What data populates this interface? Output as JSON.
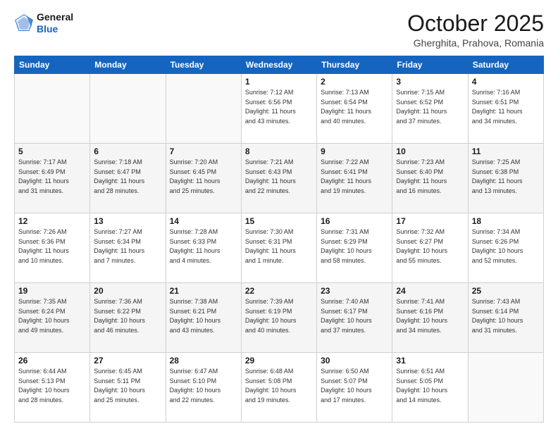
{
  "header": {
    "logo_line1": "General",
    "logo_line2": "Blue",
    "month": "October 2025",
    "location": "Gherghita, Prahova, Romania"
  },
  "days_of_week": [
    "Sunday",
    "Monday",
    "Tuesday",
    "Wednesday",
    "Thursday",
    "Friday",
    "Saturday"
  ],
  "weeks": [
    [
      {
        "day": "",
        "detail": ""
      },
      {
        "day": "",
        "detail": ""
      },
      {
        "day": "",
        "detail": ""
      },
      {
        "day": "1",
        "detail": "Sunrise: 7:12 AM\nSunset: 6:56 PM\nDaylight: 11 hours\nand 43 minutes."
      },
      {
        "day": "2",
        "detail": "Sunrise: 7:13 AM\nSunset: 6:54 PM\nDaylight: 11 hours\nand 40 minutes."
      },
      {
        "day": "3",
        "detail": "Sunrise: 7:15 AM\nSunset: 6:52 PM\nDaylight: 11 hours\nand 37 minutes."
      },
      {
        "day": "4",
        "detail": "Sunrise: 7:16 AM\nSunset: 6:51 PM\nDaylight: 11 hours\nand 34 minutes."
      }
    ],
    [
      {
        "day": "5",
        "detail": "Sunrise: 7:17 AM\nSunset: 6:49 PM\nDaylight: 11 hours\nand 31 minutes."
      },
      {
        "day": "6",
        "detail": "Sunrise: 7:18 AM\nSunset: 6:47 PM\nDaylight: 11 hours\nand 28 minutes."
      },
      {
        "day": "7",
        "detail": "Sunrise: 7:20 AM\nSunset: 6:45 PM\nDaylight: 11 hours\nand 25 minutes."
      },
      {
        "day": "8",
        "detail": "Sunrise: 7:21 AM\nSunset: 6:43 PM\nDaylight: 11 hours\nand 22 minutes."
      },
      {
        "day": "9",
        "detail": "Sunrise: 7:22 AM\nSunset: 6:41 PM\nDaylight: 11 hours\nand 19 minutes."
      },
      {
        "day": "10",
        "detail": "Sunrise: 7:23 AM\nSunset: 6:40 PM\nDaylight: 11 hours\nand 16 minutes."
      },
      {
        "day": "11",
        "detail": "Sunrise: 7:25 AM\nSunset: 6:38 PM\nDaylight: 11 hours\nand 13 minutes."
      }
    ],
    [
      {
        "day": "12",
        "detail": "Sunrise: 7:26 AM\nSunset: 6:36 PM\nDaylight: 11 hours\nand 10 minutes."
      },
      {
        "day": "13",
        "detail": "Sunrise: 7:27 AM\nSunset: 6:34 PM\nDaylight: 11 hours\nand 7 minutes."
      },
      {
        "day": "14",
        "detail": "Sunrise: 7:28 AM\nSunset: 6:33 PM\nDaylight: 11 hours\nand 4 minutes."
      },
      {
        "day": "15",
        "detail": "Sunrise: 7:30 AM\nSunset: 6:31 PM\nDaylight: 11 hours\nand 1 minute."
      },
      {
        "day": "16",
        "detail": "Sunrise: 7:31 AM\nSunset: 6:29 PM\nDaylight: 10 hours\nand 58 minutes."
      },
      {
        "day": "17",
        "detail": "Sunrise: 7:32 AM\nSunset: 6:27 PM\nDaylight: 10 hours\nand 55 minutes."
      },
      {
        "day": "18",
        "detail": "Sunrise: 7:34 AM\nSunset: 6:26 PM\nDaylight: 10 hours\nand 52 minutes."
      }
    ],
    [
      {
        "day": "19",
        "detail": "Sunrise: 7:35 AM\nSunset: 6:24 PM\nDaylight: 10 hours\nand 49 minutes."
      },
      {
        "day": "20",
        "detail": "Sunrise: 7:36 AM\nSunset: 6:22 PM\nDaylight: 10 hours\nand 46 minutes."
      },
      {
        "day": "21",
        "detail": "Sunrise: 7:38 AM\nSunset: 6:21 PM\nDaylight: 10 hours\nand 43 minutes."
      },
      {
        "day": "22",
        "detail": "Sunrise: 7:39 AM\nSunset: 6:19 PM\nDaylight: 10 hours\nand 40 minutes."
      },
      {
        "day": "23",
        "detail": "Sunrise: 7:40 AM\nSunset: 6:17 PM\nDaylight: 10 hours\nand 37 minutes."
      },
      {
        "day": "24",
        "detail": "Sunrise: 7:41 AM\nSunset: 6:16 PM\nDaylight: 10 hours\nand 34 minutes."
      },
      {
        "day": "25",
        "detail": "Sunrise: 7:43 AM\nSunset: 6:14 PM\nDaylight: 10 hours\nand 31 minutes."
      }
    ],
    [
      {
        "day": "26",
        "detail": "Sunrise: 6:44 AM\nSunset: 5:13 PM\nDaylight: 10 hours\nand 28 minutes."
      },
      {
        "day": "27",
        "detail": "Sunrise: 6:45 AM\nSunset: 5:11 PM\nDaylight: 10 hours\nand 25 minutes."
      },
      {
        "day": "28",
        "detail": "Sunrise: 6:47 AM\nSunset: 5:10 PM\nDaylight: 10 hours\nand 22 minutes."
      },
      {
        "day": "29",
        "detail": "Sunrise: 6:48 AM\nSunset: 5:08 PM\nDaylight: 10 hours\nand 19 minutes."
      },
      {
        "day": "30",
        "detail": "Sunrise: 6:50 AM\nSunset: 5:07 PM\nDaylight: 10 hours\nand 17 minutes."
      },
      {
        "day": "31",
        "detail": "Sunrise: 6:51 AM\nSunset: 5:05 PM\nDaylight: 10 hours\nand 14 minutes."
      },
      {
        "day": "",
        "detail": ""
      }
    ]
  ]
}
